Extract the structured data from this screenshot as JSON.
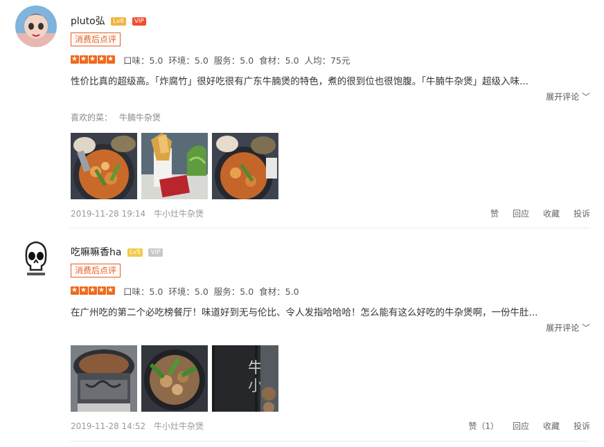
{
  "reviews": [
    {
      "user": "pluto弘",
      "level": "Lv6",
      "vip": "VIP",
      "tag": "消费后点评",
      "scores": [
        "口味：5.0",
        "环境：5.0",
        "服务：5.0",
        "食材：5.0",
        "人均：75元"
      ],
      "text": "性价比真的超级高。「炸腐竹」很好吃很有广东牛腩煲的特色，煮的很到位也很饱腹。「牛腩牛杂煲」超级入味...",
      "expand": "展开评论 ﹀",
      "likes_label": "喜欢的菜：",
      "likes_dish": "牛腩牛杂煲",
      "date": "2019-11-28 19:14",
      "shop": "牛小灶牛杂煲",
      "actions": [
        "赞",
        "回应",
        "收藏",
        "投诉"
      ],
      "colors": {
        "level_badge": "#f2b33c",
        "vip_badge": "#ee4e2e"
      }
    },
    {
      "user": "吃嘛嘛香ha",
      "level": "Lv5",
      "vip": "VIP",
      "tag": "消费后点评",
      "scores": [
        "口味：5.0",
        "环境：5.0",
        "服务：5.0",
        "食材：5.0"
      ],
      "text": "在广州吃的第二个必吃榜餐厅！味道好到无与伦比、令人发指哈哈哈！怎么能有这么好吃的牛杂煲啊，一份牛肚...",
      "expand": "展开评论 ﹀",
      "date": "2019-11-28 14:52",
      "shop": "牛小灶牛杂煲",
      "actions": [
        "赞（1）",
        "回应",
        "收藏",
        "投诉"
      ],
      "colors": {
        "level_badge": "#f2c94c",
        "vip_badge": "#c8c8c8"
      }
    }
  ]
}
